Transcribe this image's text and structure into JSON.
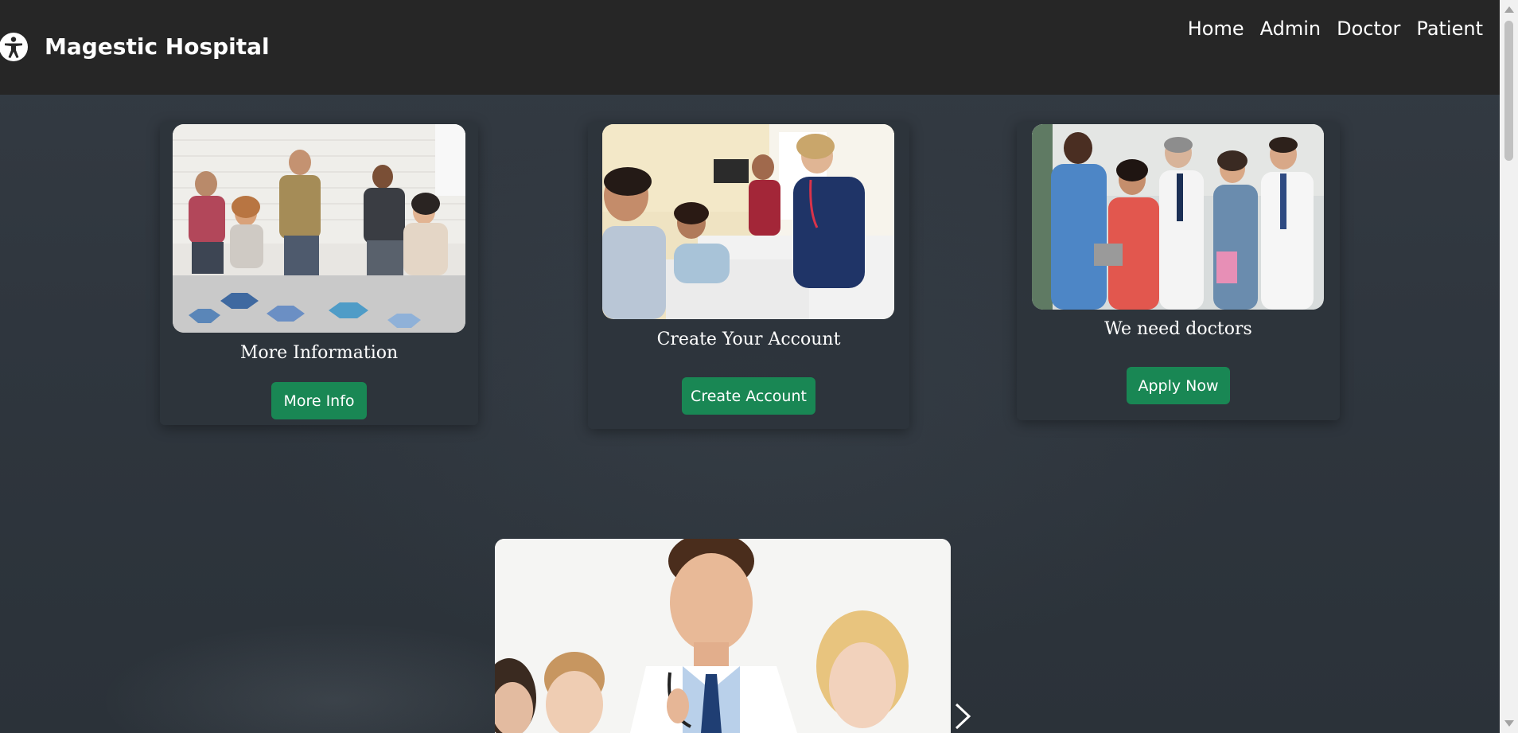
{
  "navbar": {
    "brand": "Magestic Hospital",
    "brand_icon": "accessibility-icon",
    "links": [
      "Home",
      "Admin",
      "Doctor",
      "Patient"
    ]
  },
  "cards": [
    {
      "image": "group-of-people-photo",
      "title": "More Information",
      "button": "More Info"
    },
    {
      "image": "patient-in-hospital-bed-photo",
      "title": "Create Your Account",
      "button": "Create Account"
    },
    {
      "image": "medical-staff-team-photo",
      "title": "We need doctors",
      "button": "Apply Now"
    }
  ],
  "carousel": {
    "image": "smiling-doctors-photo",
    "next_icon": "chevron-right-icon"
  },
  "colors": {
    "navbar_bg": "#262626",
    "page_bg": "#2e353d",
    "button_bg": "#198754",
    "text": "#ffffff"
  }
}
